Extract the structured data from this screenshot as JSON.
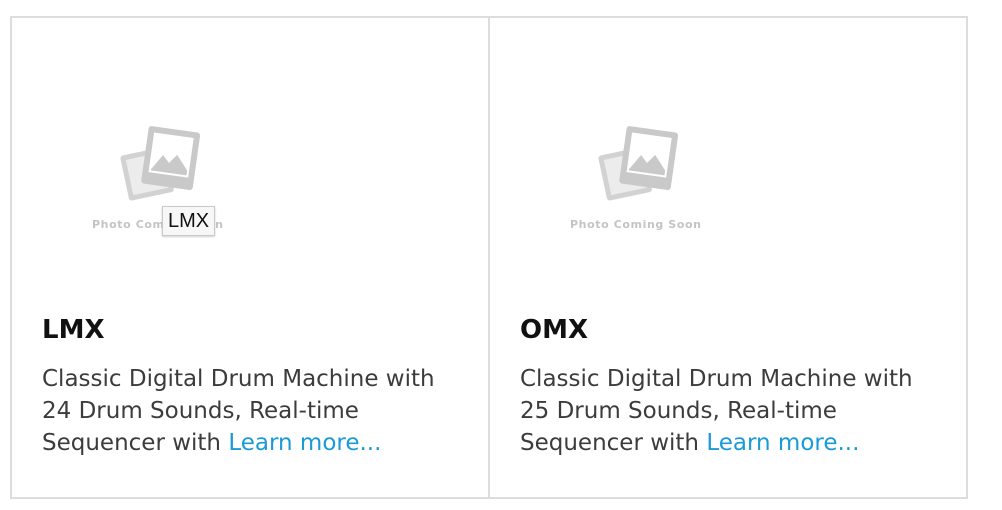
{
  "products": [
    {
      "title": "LMX",
      "placeholder_text": "Photo Coming Soon",
      "tooltip": "LMX",
      "desc_lines": [
        "Classic Digital Drum Machine with",
        "24 Drum Sounds, Real-time",
        "Sequencer with"
      ],
      "learn_more": "Learn more..."
    },
    {
      "title": "OMX",
      "placeholder_text": "Photo Coming Soon",
      "desc_lines": [
        "Classic Digital Drum Machine with",
        "25 Drum Sounds, Real-time",
        "Sequencer with"
      ],
      "learn_more": "Learn more..."
    }
  ],
  "colors": {
    "link": "#1a9ad6",
    "border": "#dcdcdc",
    "placeholder": "#c4c4c4"
  },
  "icons": {
    "placeholder": "photo-placeholder-icon"
  }
}
